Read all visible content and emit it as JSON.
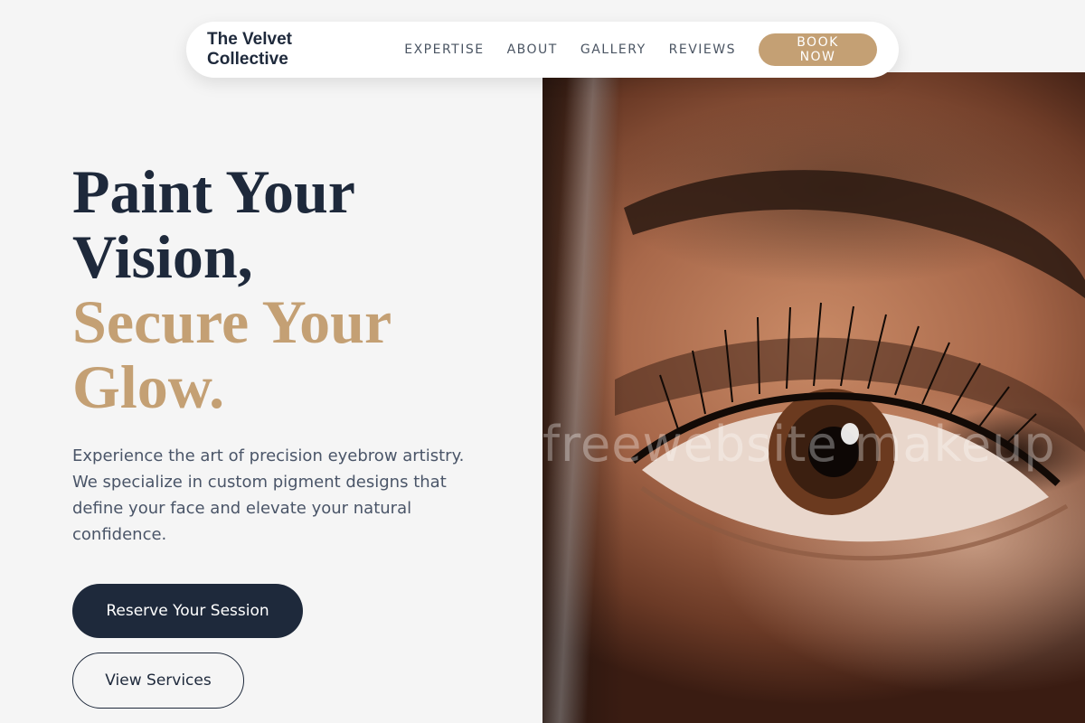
{
  "nav": {
    "brand": "The Velvet Collective",
    "links": [
      "EXPERTISE",
      "ABOUT",
      "GALLERY",
      "REVIEWS"
    ],
    "cta": "BOOK NOW"
  },
  "hero": {
    "headline_lines": [
      "Paint Your",
      "Vision,"
    ],
    "accent_lines": [
      "Secure Your",
      "Glow."
    ],
    "description": "Experience the art of precision eyebrow artistry. We specialize in custom pigment designs that define your face and elevate your natural confidence.",
    "primary_button": "Reserve Your Session",
    "secondary_button": "View Services",
    "watermark": "freewebsite makeup"
  },
  "colors": {
    "navy": "#1e293b",
    "accent_gold": "#c4a074",
    "background": "#f5f5f5"
  }
}
